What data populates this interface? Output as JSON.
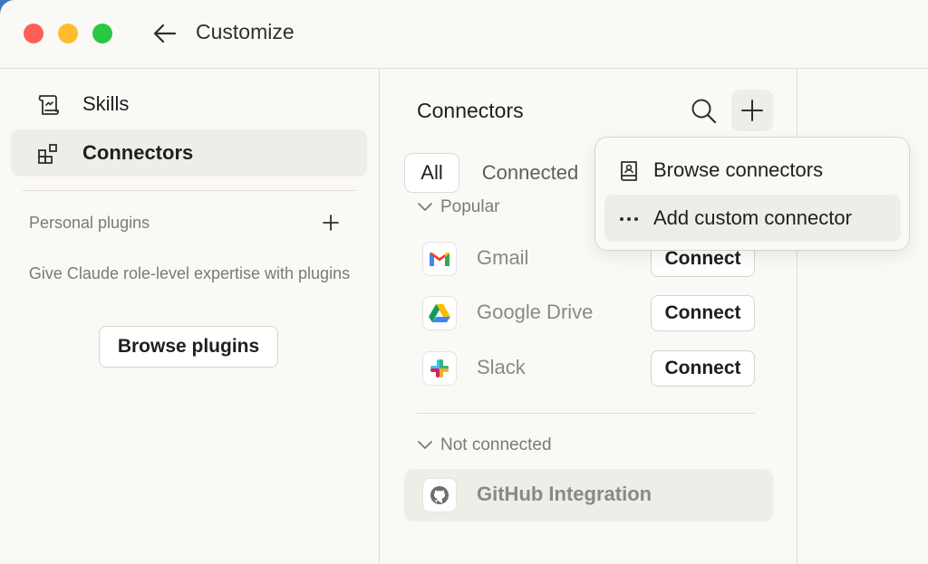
{
  "window": {
    "title": "Customize"
  },
  "sidebar": {
    "items": [
      {
        "label": "Skills",
        "icon": "scroll-icon",
        "active": false
      },
      {
        "label": "Connectors",
        "icon": "blocks-icon",
        "active": true
      }
    ],
    "personal_plugins": {
      "label": "Personal plugins",
      "empty_text": "Give Claude role-level expertise with plugins",
      "browse_label": "Browse plugins"
    }
  },
  "main": {
    "title": "Connectors",
    "tabs": [
      {
        "label": "All",
        "selected": true
      },
      {
        "label": "Connected",
        "selected": false
      }
    ],
    "groups": {
      "popular": {
        "label": "Popular",
        "items": [
          {
            "name": "Gmail",
            "icon": "gmail-icon",
            "action": "Connect"
          },
          {
            "name": "Google Drive",
            "icon": "google-drive-icon",
            "action": "Connect"
          },
          {
            "name": "Slack",
            "icon": "slack-icon",
            "action": "Connect"
          }
        ]
      },
      "not_connected": {
        "label": "Not connected",
        "items": [
          {
            "name": "GitHub Integration",
            "icon": "github-icon"
          }
        ]
      }
    }
  },
  "dropdown": {
    "items": [
      {
        "label": "Browse connectors",
        "icon": "book-user-icon"
      },
      {
        "label": "Add custom connector",
        "icon": "more-horizontal-icon"
      }
    ]
  },
  "colors": {
    "background": "#faf9f6",
    "active_item": "#efede8",
    "border": "#dedcd5",
    "muted_text": "#7b7a75",
    "traffic_red": "#ff5f57",
    "traffic_yellow": "#febc2e",
    "traffic_green": "#28c840"
  }
}
